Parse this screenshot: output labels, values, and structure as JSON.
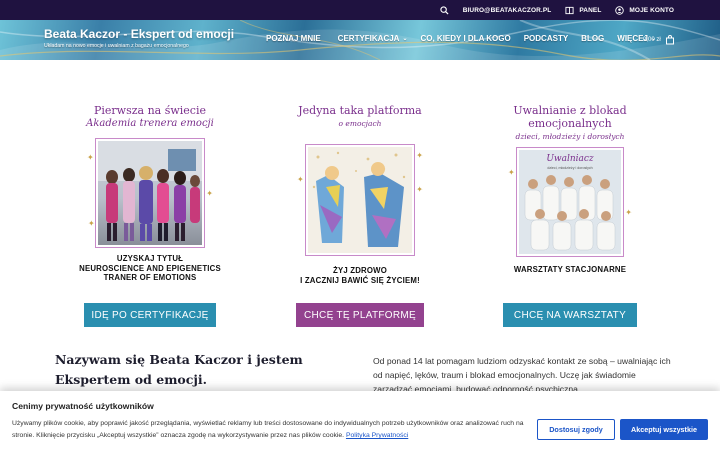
{
  "topbar": {
    "email": "BIURO@BEATAKACZOR.PL",
    "panel": "PANEL",
    "account": "MOJE KONTO",
    "icons": [
      "search-icon",
      "book-icon",
      "user-icon"
    ]
  },
  "header": {
    "site_title": "Beata Kaczor - Ekspert od emocji",
    "tagline": "Układam na nowo emocje i uwalniam z bagażu emocjonalnego",
    "nav": [
      {
        "label": "POZNAJ MNIE",
        "has_dropdown": false
      },
      {
        "label": "CERTYFIKACJA",
        "has_dropdown": true
      },
      {
        "label": "CO, KIEDY I DLA KOGO",
        "has_dropdown": false
      },
      {
        "label": "PODCASTY",
        "has_dropdown": false
      },
      {
        "label": "BLOG",
        "has_dropdown": false
      },
      {
        "label": "WIĘCEJ",
        "has_dropdown": true
      }
    ],
    "cart_amount": "0,00 zł"
  },
  "columns": [
    {
      "heading_line1": "Pierwsza na świecie",
      "heading_line2": "Akademia trenera emocji",
      "caption_line1": "UZYSKAJ TYTUŁ",
      "caption_line2": "NEUROSCIENCE AND EPIGENETICS",
      "caption_line3": "TRANER OF EMOTIONS",
      "cta": "IDĘ PO CERTYFIKACJĘ",
      "cta_color": "#2a8fb0"
    },
    {
      "heading_line1": "Jedyna taka platforma",
      "heading_line2": "o emocjach",
      "caption_line1": "ŻYJ ZDROWO",
      "caption_line2": "I ZACZNIJ BAWIĆ SIĘ ŻYCIEM!",
      "cta": "CHCĘ TĘ PLATFORMĘ",
      "cta_color": "#93428f"
    },
    {
      "heading_line1": "Uwalnianie z blokad",
      "heading_line2": "emocjonalnych",
      "heading_line3": "dzieci, młodzieży i dorosłych",
      "photo_label_line1": "Uwalniacz",
      "photo_label_line2": "dzieci, młodzieży i dorosłych",
      "caption_line1": "WARSZTATY STACJONARNE",
      "cta": "CHCĘ NA WARSZTATY",
      "cta_color": "#2a8fb0"
    }
  ],
  "about": {
    "title": "Nazywam się Beata Kaczor i jestem Ekspertem od emocji.",
    "text": "Od ponad 14 lat pomagam ludziom odzyskać kontakt ze sobą – uwalniając ich od napięć, lęków, traum i blokad emocjonalnych. Uczę jak świadomie zarządzać emocjami, budować odporność psychiczną"
  },
  "cookie": {
    "title": "Cenimy prywatność użytkowników",
    "text": "Używamy plików cookie, aby poprawić jakość przeglądania, wyświetlać reklamy lub treści dostosowane do indywidualnych potrzeb użytkowników oraz analizować ruch na stronie. Kliknięcie przycisku „Akceptuj wszystkie” oznacza zgodę na wykorzystywanie przez nas plików cookie.",
    "link": "Polityka Prywatności",
    "customize": "Dostosuj zgody",
    "accept": "Akceptuj wszystkie"
  },
  "colors": {
    "topbar": "#1f1240",
    "accent_purple": "#7a2f8c",
    "cookie_blue": "#1b55c8"
  }
}
